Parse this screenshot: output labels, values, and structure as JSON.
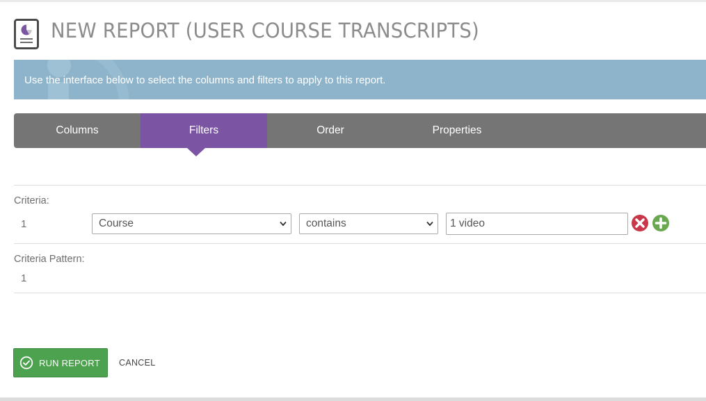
{
  "header": {
    "title": "NEW REPORT (USER COURSE TRANSCRIPTS)",
    "icon": "report-pie-icon"
  },
  "banner": {
    "text": "Use the interface below to select the columns and filters to apply to this report.",
    "icon": "info-icon"
  },
  "tabs": [
    {
      "label": "Columns",
      "active": false
    },
    {
      "label": "Filters",
      "active": true
    },
    {
      "label": "Order",
      "active": false
    },
    {
      "label": "Properties",
      "active": false
    }
  ],
  "criteria": {
    "label": "Criteria:",
    "rows": [
      {
        "number": "1",
        "field": "Course",
        "operator": "contains",
        "value": "1 video"
      }
    ]
  },
  "criteria_pattern": {
    "label": "Criteria Pattern:",
    "value": "1"
  },
  "actions": {
    "run_label": "RUN REPORT",
    "cancel_label": "CANCEL"
  },
  "colors": {
    "tab_active": "#7b54a4",
    "tab_bar": "#757575",
    "banner": "#8db4cb",
    "run_button": "#4ca24e",
    "remove_icon": "#c8384a",
    "add_icon": "#6aa84f"
  }
}
